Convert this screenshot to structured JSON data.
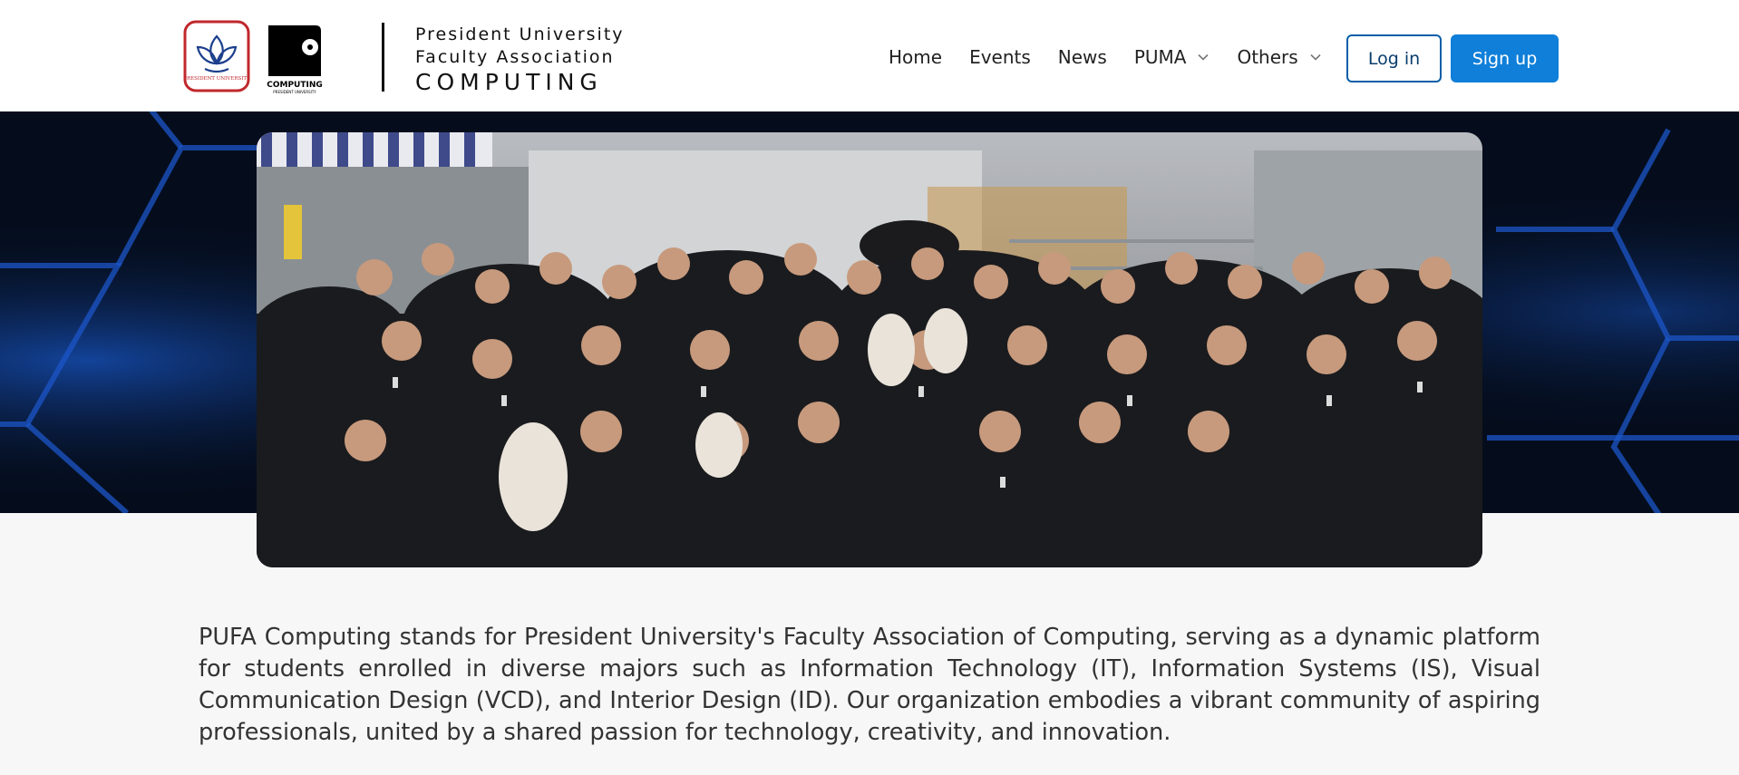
{
  "brand": {
    "line1": "President University",
    "line2": "Faculty Association",
    "line3": "COMPUTING",
    "pu_logo_text": "PRESIDENT UNIVERSITY",
    "computing_logo_text": "COMPUTING",
    "computing_logo_subtext": "PRESIDENT UNIVERSITY"
  },
  "nav": {
    "items": [
      {
        "label": "Home",
        "dropdown": false
      },
      {
        "label": "Events",
        "dropdown": false
      },
      {
        "label": "News",
        "dropdown": false
      },
      {
        "label": "PUMA",
        "dropdown": true
      },
      {
        "label": "Others",
        "dropdown": true
      }
    ],
    "login_label": "Log in",
    "signup_label": "Sign up"
  },
  "colors": {
    "accent": "#0f7fd9",
    "login_border": "#0a5ea8",
    "hero_bg": "#050d1d",
    "glow": "#1e6fff"
  },
  "icons": {
    "dropdown": "chevron-down-icon"
  },
  "description": "PUFA Computing stands for President University's Faculty Association of Computing, serving as a dynamic platform for students enrolled in diverse majors such as Information Technology (IT), Information Systems (IS), Visual Communication Design (VCD), and Interior Design (ID). Our organization embodies a vibrant community of aspiring professionals, united by a shared passion for technology, creativity, and innovation."
}
